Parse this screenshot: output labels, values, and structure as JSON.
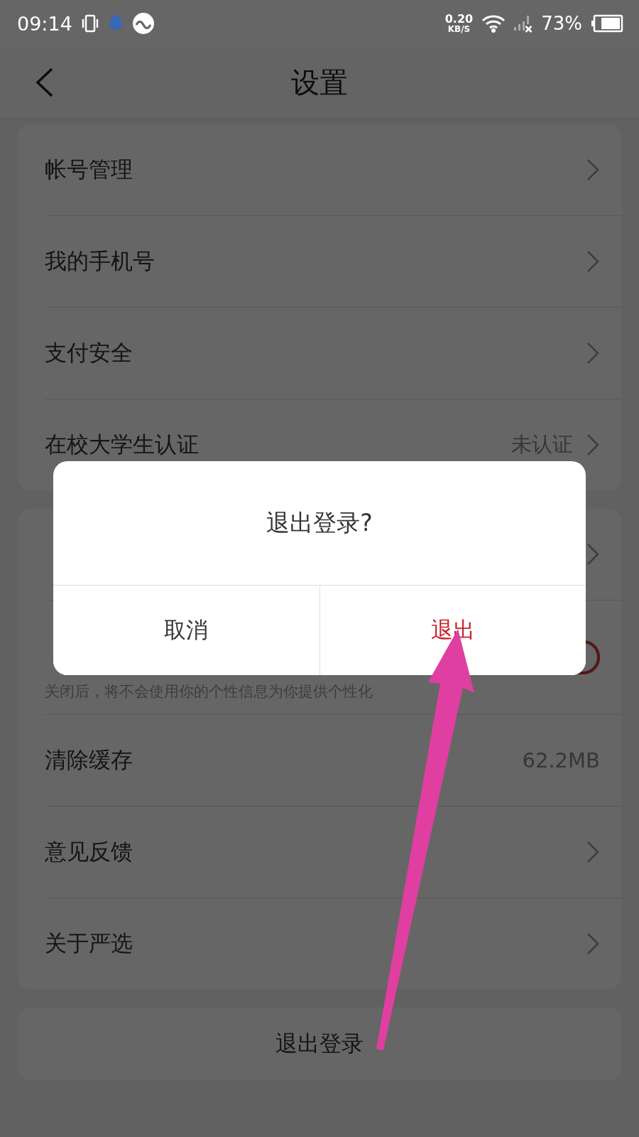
{
  "status_bar": {
    "time": "09:14",
    "speed_value": "0.20",
    "speed_unit": "KB/S",
    "battery": "73%"
  },
  "header": {
    "title": "设置"
  },
  "groups": [
    {
      "items": [
        {
          "kind": "link",
          "label": "帐号管理"
        },
        {
          "kind": "link",
          "label": "我的手机号"
        },
        {
          "kind": "link",
          "label": "支付安全"
        },
        {
          "kind": "link",
          "label": "在校大学生认证",
          "value": "未认证"
        }
      ]
    },
    {
      "items": [
        {
          "kind": "link"
        },
        {
          "kind": "toggle",
          "description": "关闭后，将不会使用你的个性信息为你提供个性化",
          "on": true
        },
        {
          "kind": "value",
          "label": "清除缓存",
          "value": "62.2MB"
        },
        {
          "kind": "link",
          "label": "意见反馈"
        },
        {
          "kind": "link",
          "label": "关于严选"
        }
      ]
    }
  ],
  "logout_button": "退出登录",
  "dialog": {
    "title": "退出登录?",
    "buttons": [
      {
        "label": "取消",
        "kind": "cancel"
      },
      {
        "label": "退出",
        "kind": "confirm"
      }
    ]
  }
}
